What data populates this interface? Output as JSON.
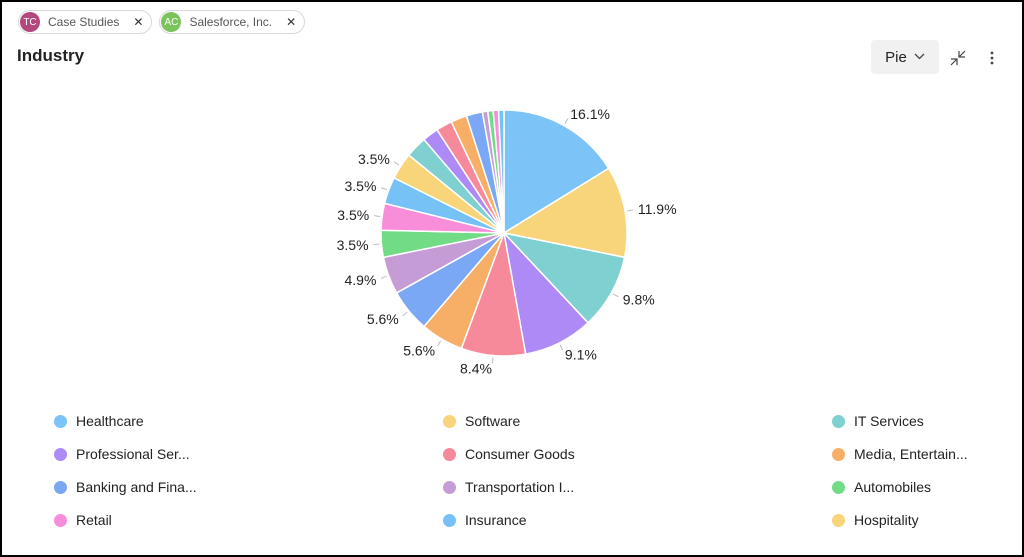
{
  "filters": [
    {
      "initials": "TC",
      "label": "Case Studies",
      "color": "#b5477f"
    },
    {
      "initials": "AC",
      "label": "Salesforce, Inc.",
      "color": "#7bc35d"
    }
  ],
  "header": {
    "title": "Industry",
    "chart_type_label": "Pie"
  },
  "chart_data": {
    "type": "pie",
    "slices": [
      {
        "name": "Healthcare",
        "value": 16.1,
        "color": "#7cc3f8",
        "label": "16.1%"
      },
      {
        "name": "Software",
        "value": 11.9,
        "color": "#f8d47a",
        "label": "11.9%"
      },
      {
        "name": "IT Services",
        "value": 9.8,
        "color": "#7fd0d0",
        "label": "9.8%"
      },
      {
        "name": "Professional Ser...",
        "value": 9.1,
        "color": "#ad8af6",
        "label": "9.1%"
      },
      {
        "name": "Consumer Goods",
        "value": 8.4,
        "color": "#f68a9b",
        "label": "8.4%"
      },
      {
        "name": "Media, Entertain...",
        "value": 5.6,
        "color": "#f7ae67",
        "label": "5.6%"
      },
      {
        "name": "Banking and Fina...",
        "value": 5.6,
        "color": "#7ba8f4",
        "label": "5.6%"
      },
      {
        "name": "Transportation I...",
        "value": 4.9,
        "color": "#c59cd5",
        "label": "4.9%"
      },
      {
        "name": "Automobiles",
        "value": 3.5,
        "color": "#72db86",
        "label": "3.5%"
      },
      {
        "name": "Retail",
        "value": 3.5,
        "color": "#f88ed9",
        "label": "3.5%"
      },
      {
        "name": "Insurance",
        "value": 3.5,
        "color": "#76c1f6",
        "label": "3.5%"
      },
      {
        "name": "Hospitality",
        "value": 3.5,
        "color": "#f8d47a",
        "label": "3.5%"
      },
      {
        "name": "",
        "value": 2.8,
        "color": "#7fd0d0",
        "label": ""
      },
      {
        "name": "",
        "value": 2.1,
        "color": "#ad8af6",
        "label": ""
      },
      {
        "name": "",
        "value": 2.1,
        "color": "#f68a9b",
        "label": ""
      },
      {
        "name": "",
        "value": 2.1,
        "color": "#f7ae67",
        "label": ""
      },
      {
        "name": "",
        "value": 2.1,
        "color": "#7ba8f4",
        "label": ""
      },
      {
        "name": "",
        "value": 0.7,
        "color": "#c59cd5",
        "label": ""
      },
      {
        "name": "",
        "value": 0.7,
        "color": "#72db86",
        "label": ""
      },
      {
        "name": "",
        "value": 0.7,
        "color": "#f88ed9",
        "label": ""
      },
      {
        "name": "",
        "value": 0.7,
        "color": "#76c1f6",
        "label": ""
      }
    ],
    "legend": [
      {
        "name": "Healthcare",
        "color": "#7cc3f8"
      },
      {
        "name": "Software",
        "color": "#f8d47a"
      },
      {
        "name": "IT Services",
        "color": "#7fd0d0"
      },
      {
        "name": "Professional Ser...",
        "color": "#ad8af6"
      },
      {
        "name": "Consumer Goods",
        "color": "#f68a9b"
      },
      {
        "name": "Media, Entertain...",
        "color": "#f7ae67"
      },
      {
        "name": "Banking and Fina...",
        "color": "#7ba8f4"
      },
      {
        "name": "Transportation I...",
        "color": "#c59cd5"
      },
      {
        "name": "Automobiles",
        "color": "#72db86"
      },
      {
        "name": "Retail",
        "color": "#f88ed9"
      },
      {
        "name": "Insurance",
        "color": "#76c1f6"
      },
      {
        "name": "Hospitality",
        "color": "#f8d47a"
      }
    ]
  },
  "icons": {
    "collapse": "collapse-arrows-icon",
    "more": "more-vertical-icon",
    "close": "close-icon",
    "dropdown": "chevron-down-icon"
  }
}
